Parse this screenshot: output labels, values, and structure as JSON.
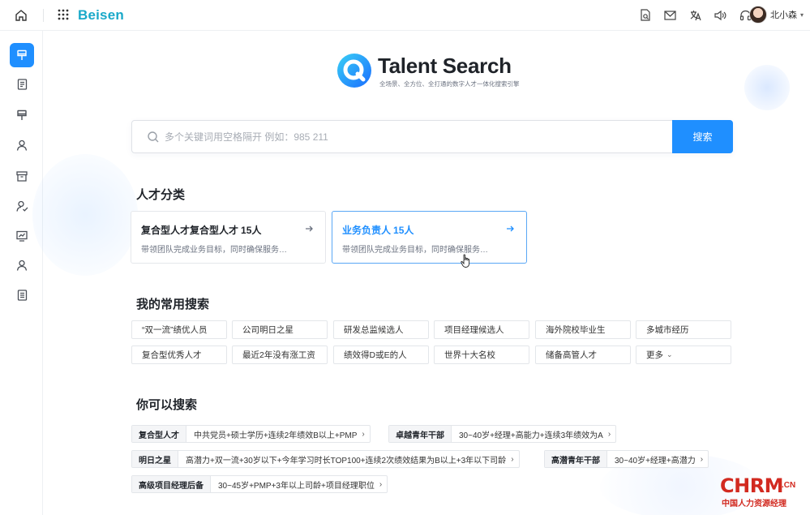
{
  "topbar": {
    "brand": "Beisen",
    "icons": [
      "file-search-icon",
      "mail-icon",
      "translate-icon",
      "speaker-icon",
      "headset-icon"
    ],
    "user_name": "北小森",
    "user_caret": "▾"
  },
  "sidebar": {
    "items": [
      {
        "icon": "brush-icon",
        "active": true
      },
      {
        "icon": "document-icon",
        "active": false
      },
      {
        "icon": "brush-icon",
        "active": false
      },
      {
        "icon": "person-icon",
        "active": false
      },
      {
        "icon": "archive-icon",
        "active": false
      },
      {
        "icon": "person-check-icon",
        "active": false
      },
      {
        "icon": "chart-screen-icon",
        "active": false
      },
      {
        "icon": "person-icon",
        "active": false
      },
      {
        "icon": "list-document-icon",
        "active": false
      }
    ]
  },
  "hero": {
    "title": "Talent Search",
    "subtitle": "全场景、全方位、全打通的数字人才一体化搜索引擎"
  },
  "search": {
    "placeholder": "多个关键词用空格隔开 例如：985 211",
    "button_label": "搜索"
  },
  "categories": {
    "title": "人才分类",
    "cards": [
      {
        "name": "复合型人才复合型人才",
        "count": "15",
        "unit": "人",
        "desc": "带领团队完成业务目标，同时确保服务…",
        "active": false
      },
      {
        "name": "业务负责人",
        "count": "15",
        "unit": "人",
        "desc": "带领团队完成业务目标，同时确保服务…",
        "active": true
      }
    ]
  },
  "frequent": {
    "title": "我的常用搜索",
    "tags": [
      "“双一流”绩优人员",
      "公司明日之星",
      "研发总监候选人",
      "项目经理候选人",
      "海外院校毕业生",
      "多城市经历",
      "复合型优秀人才",
      "最近2年没有涨工资",
      "绩效得D或E的人",
      "世界十大名校",
      "储备高管人才",
      "更多"
    ],
    "more_chevron": "⌄"
  },
  "suggest": {
    "title": "你可以搜索",
    "chips": [
      {
        "label": "复合型人才",
        "value": "中共党员+硕士学历+连续2年绩效B以上+PMP"
      },
      {
        "label": "卓越青年干部",
        "value": "30~40岁+经理+高能力+连续3年绩效为A"
      },
      {
        "label": "明日之星",
        "value": "高潜力+双一流+30岁以下+今年学习时长TOP100+连续2次绩效结果为B以上+3年以下司龄"
      },
      {
        "label": "高潜青年干部",
        "value": "30~40岁+经理+高潜力"
      },
      {
        "label": "高级项目经理后备",
        "value": "30~45岁+PMP+3年以上司龄+项目经理职位"
      }
    ],
    "arrow": "›"
  },
  "watermark": {
    "main": "CHRM",
    "domain": ".CN",
    "sub": "中国人力资源经理"
  },
  "colors": {
    "accent": "#1f8fff",
    "brand": "#1aa9c9",
    "watermark": "#d22a20"
  }
}
